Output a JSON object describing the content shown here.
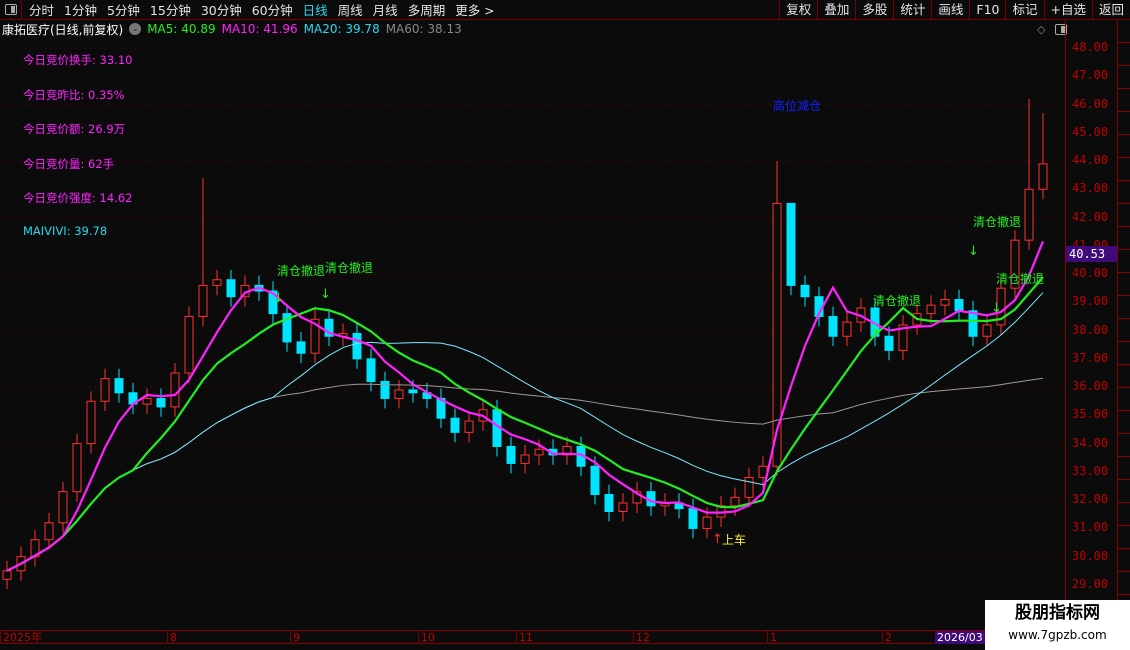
{
  "toolbar": {
    "periods": [
      "分时",
      "1分钟",
      "5分钟",
      "15分钟",
      "30分钟",
      "60分钟",
      "日线",
      "周线",
      "月线",
      "多周期",
      "更多 >"
    ],
    "active_period": "日线",
    "tools": [
      "复权",
      "叠加",
      "多股",
      "统计",
      "画线",
      "F10",
      "标记",
      "+自选",
      "返回"
    ]
  },
  "info": {
    "title": "康拓医疗(日线,前复权)",
    "ma5": "MA5: 40.89",
    "ma10": "MA10: 41.96",
    "ma20": "MA20: 39.78",
    "ma60": "MA60: 38.13"
  },
  "indicators": [
    "今日竞价换手: 33.10",
    "今日竞昨比: 0.35%",
    "今日竞价额: 26.9万",
    "今日竞价量: 62手",
    "今日竞价强度: 14.62"
  ],
  "maivivi": "MAIVIVI: 39.78",
  "signals": {
    "sell1": "清仓撤退",
    "sell2": "清仓撤退",
    "sell3": "清仓撤退",
    "sell4": "清仓撤退",
    "sell5": "清仓撤退",
    "high": "高位减仓",
    "buy": "上车"
  },
  "current_price": "40.53",
  "xaxis": {
    "labels": [
      "2025年",
      "8",
      "9",
      "10",
      "11",
      "12",
      "1",
      "2"
    ],
    "current": "2026/03"
  },
  "watermark": {
    "line1": "股朋指标网",
    "line2": "www.7gpzb.com"
  },
  "colors": {
    "up": "#ff3030",
    "down": "#00e5ff",
    "ma5": "#ff22ff",
    "ma10": "#22ee22",
    "ma20": "#7fe8ff",
    "ma60": "#9a9a9a"
  },
  "chart_data": {
    "type": "candlestick",
    "yticks": [
      "48.00",
      "47.00",
      "46.00",
      "45.00",
      "44.00",
      "43.00",
      "42.00",
      "41.00",
      "40.00",
      "39.00",
      "38.00",
      "37.00",
      "36.00",
      "35.00",
      "34.00",
      "33.00",
      "32.00",
      "31.00",
      "30.00",
      "29.00"
    ],
    "ylim": [
      29,
      48
    ],
    "closes": [
      29.5,
      30.0,
      30.6,
      31.2,
      32.3,
      34.0,
      35.5,
      36.3,
      35.8,
      35.4,
      35.6,
      35.3,
      36.5,
      38.5,
      39.6,
      39.8,
      39.2,
      39.6,
      39.4,
      38.6,
      37.6,
      37.2,
      38.4,
      37.8,
      37.9,
      37.0,
      36.2,
      35.6,
      35.9,
      35.8,
      35.6,
      34.9,
      34.4,
      34.8,
      35.2,
      33.9,
      33.3,
      33.6,
      33.8,
      33.6,
      33.9,
      33.2,
      32.2,
      31.6,
      31.9,
      32.3,
      31.8,
      31.9,
      31.7,
      31.0,
      31.4,
      31.8,
      32.1,
      32.8,
      33.2,
      42.5,
      39.6,
      39.2,
      38.5,
      37.8,
      38.3,
      38.8,
      37.8,
      37.3,
      38.2,
      38.6,
      38.9,
      39.1,
      38.7,
      37.8,
      38.2,
      39.5,
      41.2,
      43.0,
      43.9
    ],
    "highs_extra": {
      "14": 43.4,
      "55": 44.0,
      "56": 41.5,
      "73": 46.2,
      "74": 45.7
    }
  }
}
